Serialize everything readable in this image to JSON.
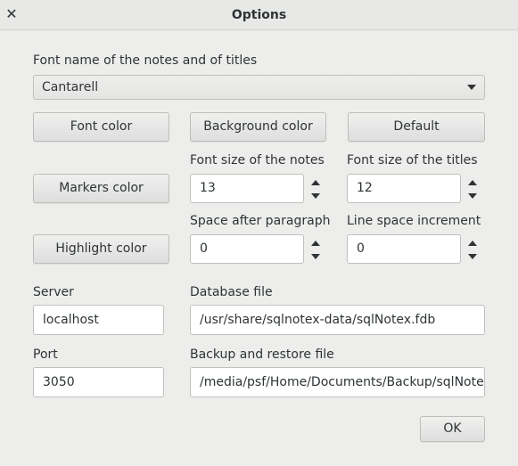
{
  "window": {
    "title": "Options",
    "close_glyph": "✕"
  },
  "font": {
    "label": "Font name of the notes and of titles",
    "selected": "Cantarell"
  },
  "buttons": {
    "font_color": "Font color",
    "background_color": "Background color",
    "default": "Default",
    "markers_color": "Markers color",
    "highlight_color": "Highlight color",
    "ok": "OK"
  },
  "spinners": {
    "notes_size": {
      "label": "Font size of the notes",
      "value": "13"
    },
    "titles_size": {
      "label": "Font size of the titles",
      "value": "12"
    },
    "space_after": {
      "label": "Space after paragraph",
      "value": "0"
    },
    "line_increment": {
      "label": "Line space increment",
      "value": "0"
    }
  },
  "connection": {
    "server_label": "Server",
    "server_value": "localhost",
    "port_label": "Port",
    "port_value": "3050",
    "db_label": "Database file",
    "db_value": "/usr/share/sqlnotex-data/sqlNotex.fdb",
    "backup_label": "Backup and restore file",
    "backup_value": "/media/psf/Home/Documents/Backup/sqlNotex-"
  },
  "icons": {
    "close": "close-icon",
    "dropdown": "chevron-down-icon",
    "spin_up": "arrow-up-icon",
    "spin_down": "arrow-down-icon"
  }
}
